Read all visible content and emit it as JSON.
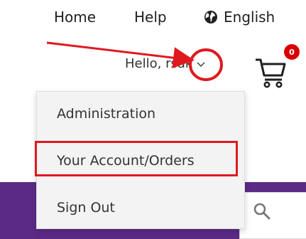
{
  "topnav": {
    "home": "Home",
    "help": "Help",
    "language": "English"
  },
  "account": {
    "greeting": "Hello, rsak"
  },
  "cart": {
    "count": "0"
  },
  "dropdown": {
    "items": [
      {
        "label": "Administration"
      },
      {
        "label": "Your Account/Orders"
      },
      {
        "label": "Sign Out"
      }
    ]
  },
  "colors": {
    "annotation": "#e0191f",
    "brand_band": "#5b2a86",
    "badge": "#d80000"
  },
  "icons": [
    "globe-icon",
    "chevron-down-icon",
    "cart-icon",
    "search-icon"
  ]
}
